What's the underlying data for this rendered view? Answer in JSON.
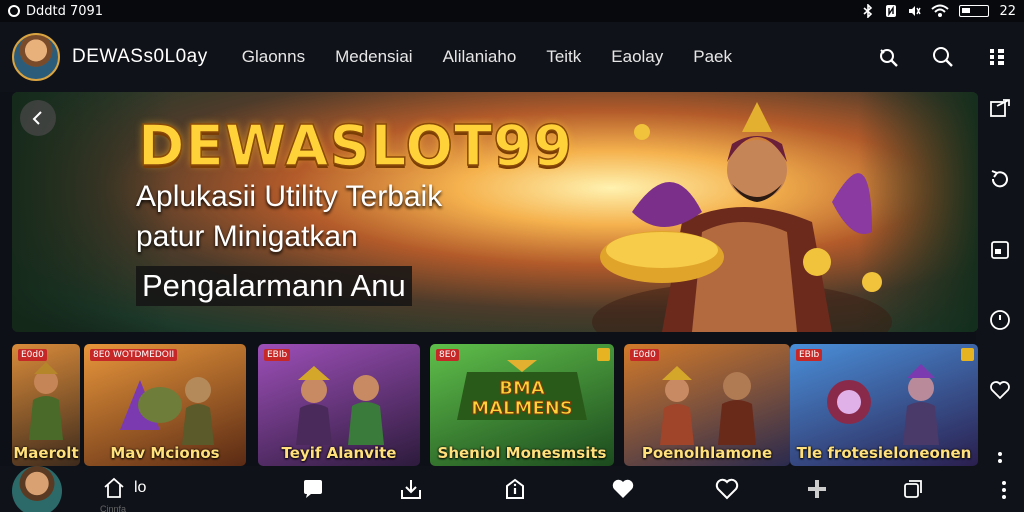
{
  "status_bar": {
    "left_text": "Dddtd 7091",
    "time": "22"
  },
  "header": {
    "brand": "DEWASs0L0ay",
    "menu": [
      "Glaonns",
      "Medensiai",
      "Alilaniaho",
      "Teitk",
      "Eaolay",
      "Paek"
    ],
    "icons": [
      "cast-icon",
      "search-icon",
      "menu-icon"
    ]
  },
  "hero": {
    "title": "DEWASLOT99",
    "line1": "Aplukasii Utility Terbaik",
    "line2": "patur Minigatkan",
    "line3": "Pengalarmann Anu"
  },
  "cards": [
    {
      "tag": "E0d0",
      "title": "Maerolt",
      "color_a": "#d98b3a",
      "color_b": "#3d2a1c"
    },
    {
      "tag": "8E0 WOTDMEDOII",
      "title": "Mav Mcionos",
      "color_a": "#e8963b",
      "color_b": "#5a2a14"
    },
    {
      "tag": "EBIb",
      "title": "Teyif Alanvite",
      "color_a": "#9d4fb8",
      "color_b": "#2d1b3c"
    },
    {
      "tag": "8E0",
      "title": "Sheniol Monesmsits",
      "color_a": "#5fbf4a",
      "color_b": "#1c4a1e"
    },
    {
      "tag": "E0d0",
      "title": "Poenolhlamone",
      "color_a": "#d27a2a",
      "color_b": "#2a2a4e"
    },
    {
      "tag": "EBIb",
      "title": "Tle frotesieloneonen",
      "color_a": "#4a8fd9",
      "color_b": "#2a1f4e"
    }
  ],
  "bottom_bar": {
    "home_text": "lo",
    "home_label": "Cinnfa"
  },
  "colors": {
    "accent_gold": "#ffd23a",
    "background": "#0d1016",
    "tag_red": "#c62828"
  }
}
